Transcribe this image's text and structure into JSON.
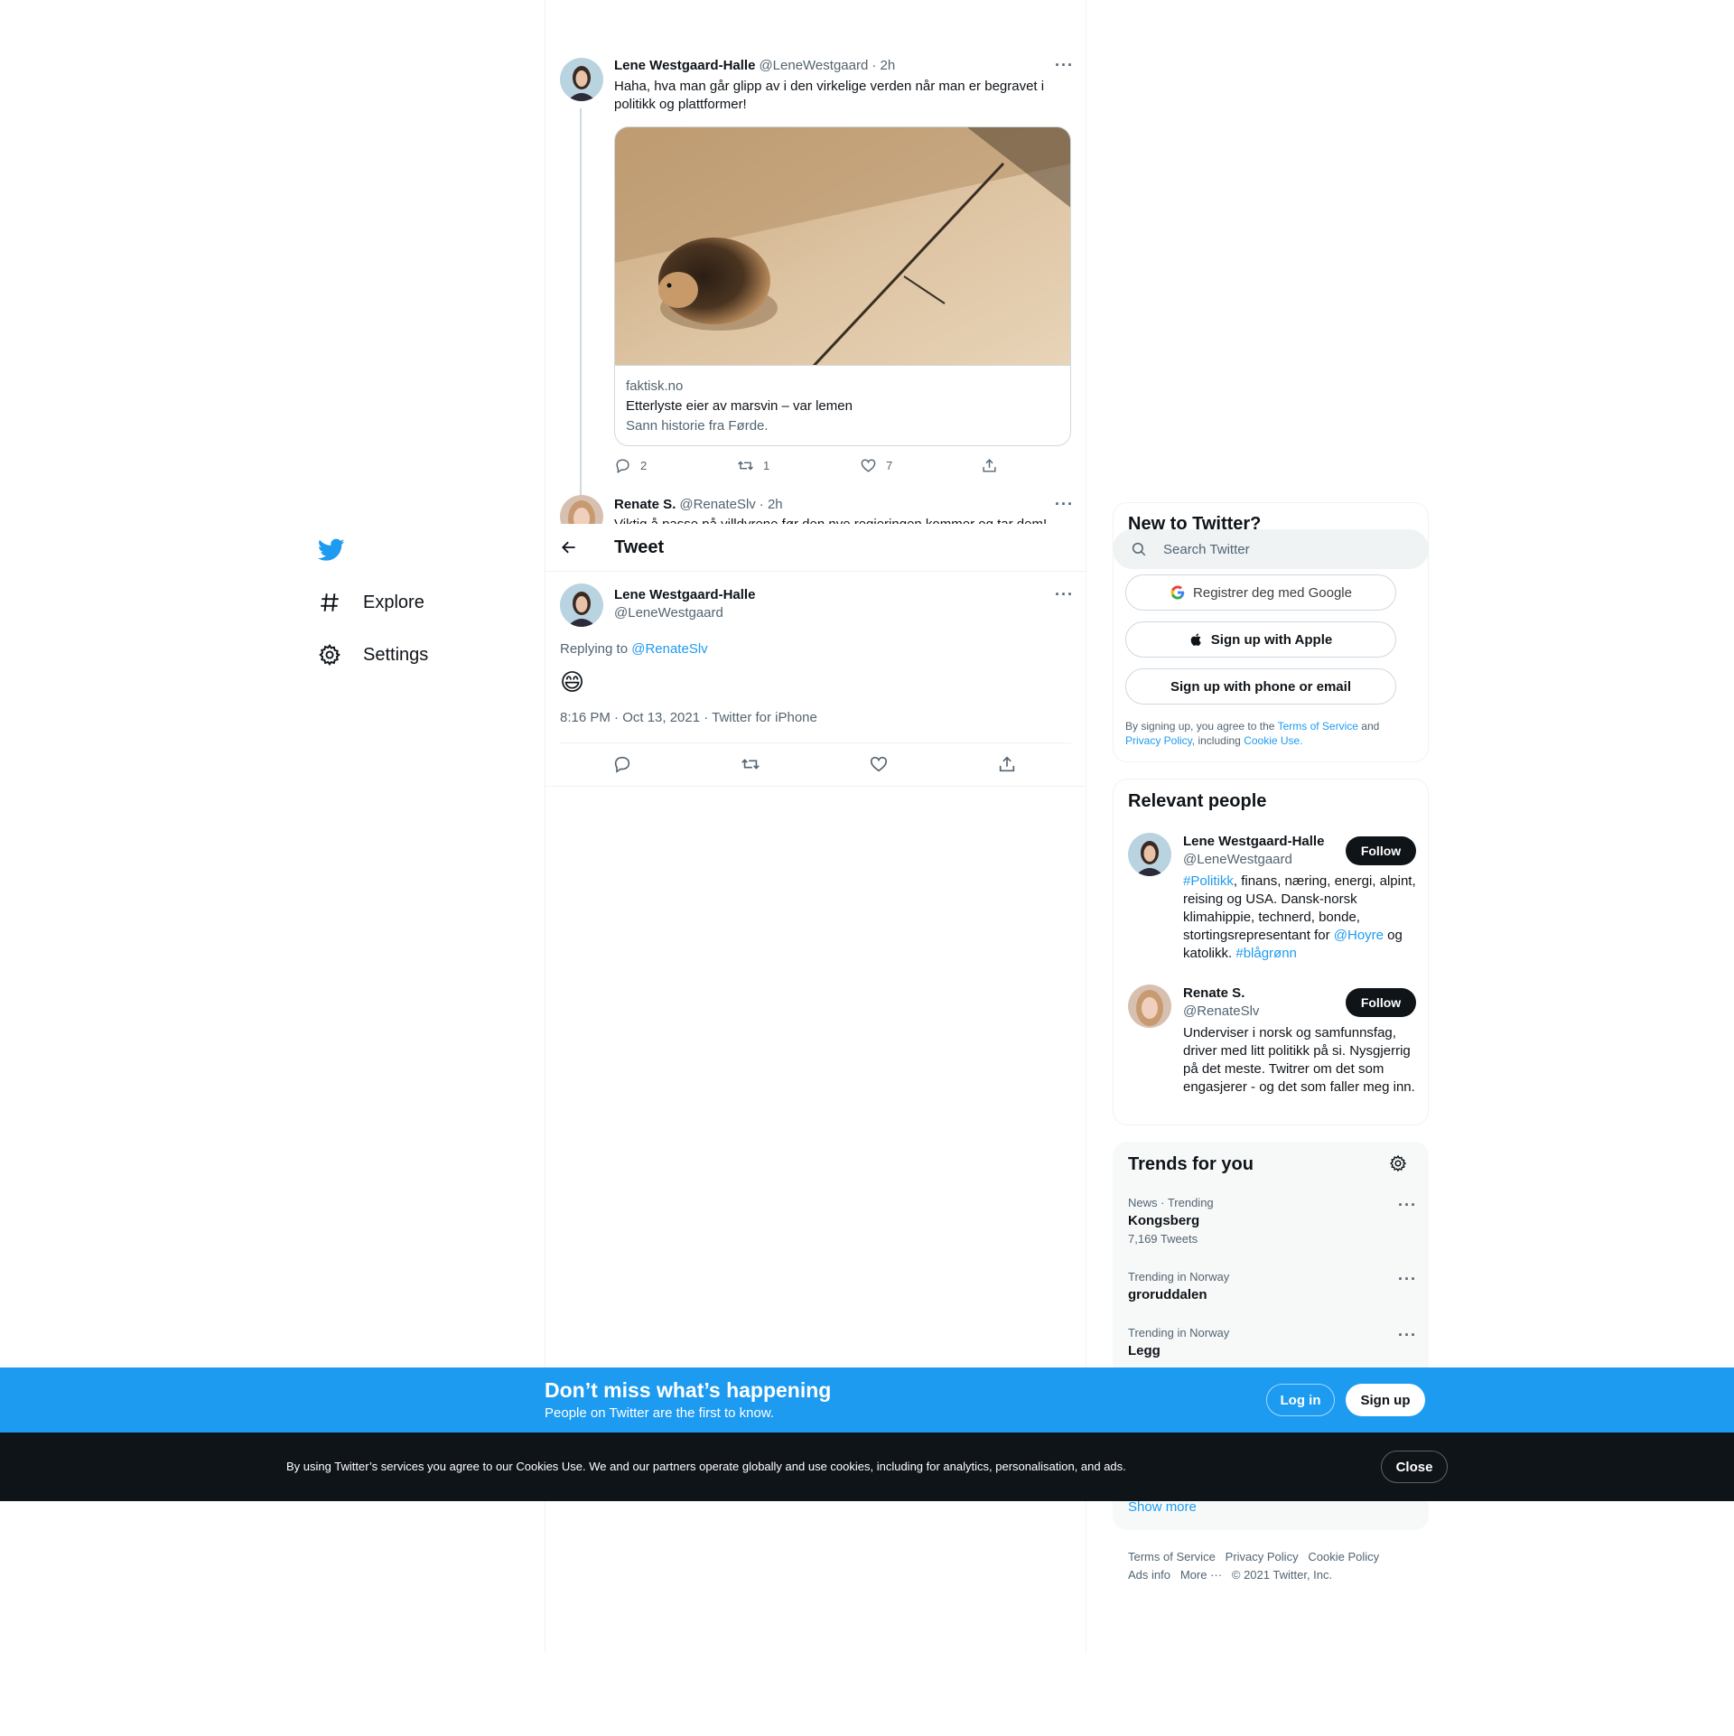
{
  "nav": {
    "explore": "Explore",
    "settings": "Settings"
  },
  "thread_tweet": {
    "name": "Lene Westgaard-Halle",
    "handle": "@LeneWestgaard",
    "time": "· 2h",
    "text": "Haha, hva man går glipp av i den virkelige verden når man er begravet i politikk og plattformer!",
    "card": {
      "domain": "faktisk.no",
      "title": "Etterlyste eier av marsvin – var lemen",
      "description": "Sann historie fra Førde."
    },
    "replies": "2",
    "retweets": "1",
    "likes": "7"
  },
  "prev_tweet": {
    "name": "Renate S.",
    "handle": "@RenateSlv",
    "time": "· 2h",
    "text": "Viktig å passe på villdyrene før den nye regjeringen kommer og tar dem!"
  },
  "header": {
    "title": "Tweet"
  },
  "main_tweet": {
    "name": "Lene Westgaard-Halle",
    "handle": "@LeneWestgaard",
    "replying_prefix": "Replying to",
    "replying_handle": "@RenateSlv",
    "emoji": "😄",
    "meta": "8:16 PM · Oct 13, 2021 · Twitter for iPhone"
  },
  "sidebar": {
    "new_to_twitter": "New to Twitter?",
    "search_placeholder": "Search Twitter",
    "google_btn": "Registrer deg med Google",
    "apple_btn": "Sign up with Apple",
    "phone_btn": "Sign up with phone or email",
    "legal_prefix": "By signing up, you agree to the",
    "legal_tos": "Terms of Service",
    "legal_and": "and",
    "legal_privacy": "Privacy Policy",
    "legal_including": ", including",
    "legal_cookie": "Cookie Use.",
    "relevant_title": "Relevant people",
    "people": [
      {
        "name": "Lene Westgaard-Halle",
        "handle": "@LeneWestgaard",
        "follow": "Follow",
        "bio_tag1": "#Politikk",
        "bio_part1": ", finans, næring, energi, alpint, reising og USA. Dansk-norsk klimahippie, technerd, bonde, stortingsrepresentant for ",
        "bio_mention": "@Hoyre",
        "bio_part2": " og katolikk. ",
        "bio_tag2": "#blågrønn"
      },
      {
        "name": "Renate S.",
        "handle": "@RenateSlv",
        "follow": "Follow",
        "bio": "Underviser i norsk og samfunnsfag, driver med litt politikk på si. Nysgjerrig på det meste. Twitrer om det som engasjerer - og det som faller meg inn."
      }
    ],
    "trends_title": "Trends for you",
    "trends": [
      {
        "context": "News · Trending",
        "name": "Kongsberg",
        "count": "7,169 Tweets"
      },
      {
        "context": "Trending in Norway",
        "name": "groruddalen",
        "count": ""
      },
      {
        "context": "Trending in Norway",
        "name": "Legg",
        "count": ""
      }
    ],
    "show_more": "Show more",
    "footer": {
      "tos": "Terms of Service",
      "privacy": "Privacy Policy",
      "cookie": "Cookie Policy",
      "ads": "Ads info",
      "more": "More ···",
      "copyright": "© 2021 Twitter, Inc."
    }
  },
  "banner": {
    "title": "Don’t miss what’s happening",
    "subtitle": "People on Twitter are the first to know.",
    "login": "Log in",
    "signup": "Sign up"
  },
  "cookie_bar": {
    "text": "By using Twitter’s services you agree to our Cookies Use. We and our partners operate globally and use cookies, including for analytics, personalisation, and ads.",
    "close": "Close"
  },
  "colors": {
    "accent": "#1d9bf0",
    "text": "#0f1419",
    "muted": "#536471",
    "dark": "#0f1419"
  }
}
